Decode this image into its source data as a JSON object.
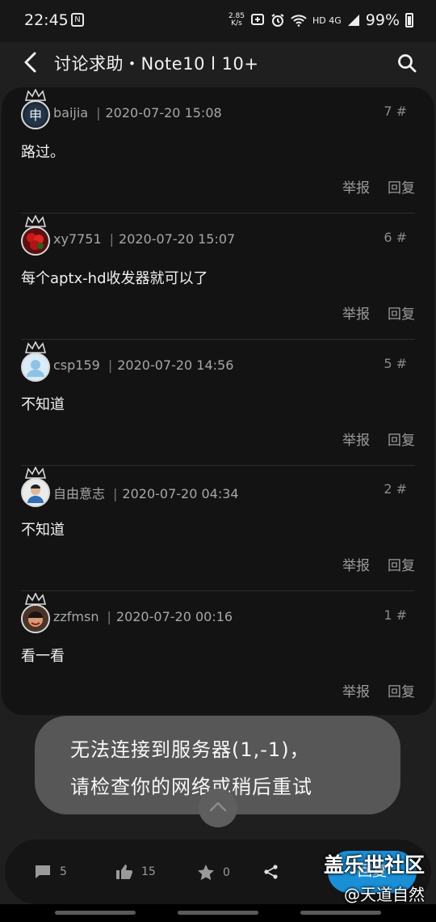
{
  "status_bar": {
    "time": "22:45",
    "net_speed_value": "2.85",
    "net_speed_unit": "K/s",
    "network": "HD 4G",
    "battery": "99%",
    "icons": [
      "notification-icon",
      "vibrate-icon",
      "alarm-icon",
      "wifi-icon",
      "signal-icon",
      "battery-icon"
    ]
  },
  "header": {
    "title": "讨论求助・Note10 l 10+",
    "back_icon": "chevron-left-icon",
    "search_icon": "search-icon"
  },
  "posts": [
    {
      "username": "baijia",
      "datetime": "2020-07-20 15:08",
      "floor": "7 #",
      "content": "路过。",
      "report_label": "举报",
      "reply_label": "回复"
    },
    {
      "username": "xy7751",
      "datetime": "2020-07-20 15:07",
      "floor": "6 #",
      "content": "每个aptx-hd收发器就可以了",
      "report_label": "举报",
      "reply_label": "回复"
    },
    {
      "username": "csp159",
      "datetime": "2020-07-20 14:56",
      "floor": "5 #",
      "content": "不知道",
      "report_label": "举报",
      "reply_label": "回复"
    },
    {
      "username": "自由意志",
      "datetime": "2020-07-20 04:34",
      "floor": "2 #",
      "content": "不知道",
      "report_label": "举报",
      "reply_label": "回复"
    },
    {
      "username": "zzfmsn",
      "datetime": "2020-07-20 00:16",
      "floor": "1 #",
      "content": "看一看",
      "report_label": "举报",
      "reply_label": "回复"
    }
  ],
  "toast": {
    "line1": "无法连接到服务器(1,-1)，",
    "line2": "请检查你的网络或稍后重试"
  },
  "bottom_bar": {
    "comments_count": "5",
    "likes_count": "15",
    "favorites_count": "0",
    "reply_label": "回复"
  },
  "watermark": {
    "line1": "盖乐世社区",
    "line2": "@天道自然"
  },
  "colors": {
    "background": "#1f1f1f",
    "card": "#131313",
    "toast": "#575757",
    "accent": "#1a8fd6"
  }
}
